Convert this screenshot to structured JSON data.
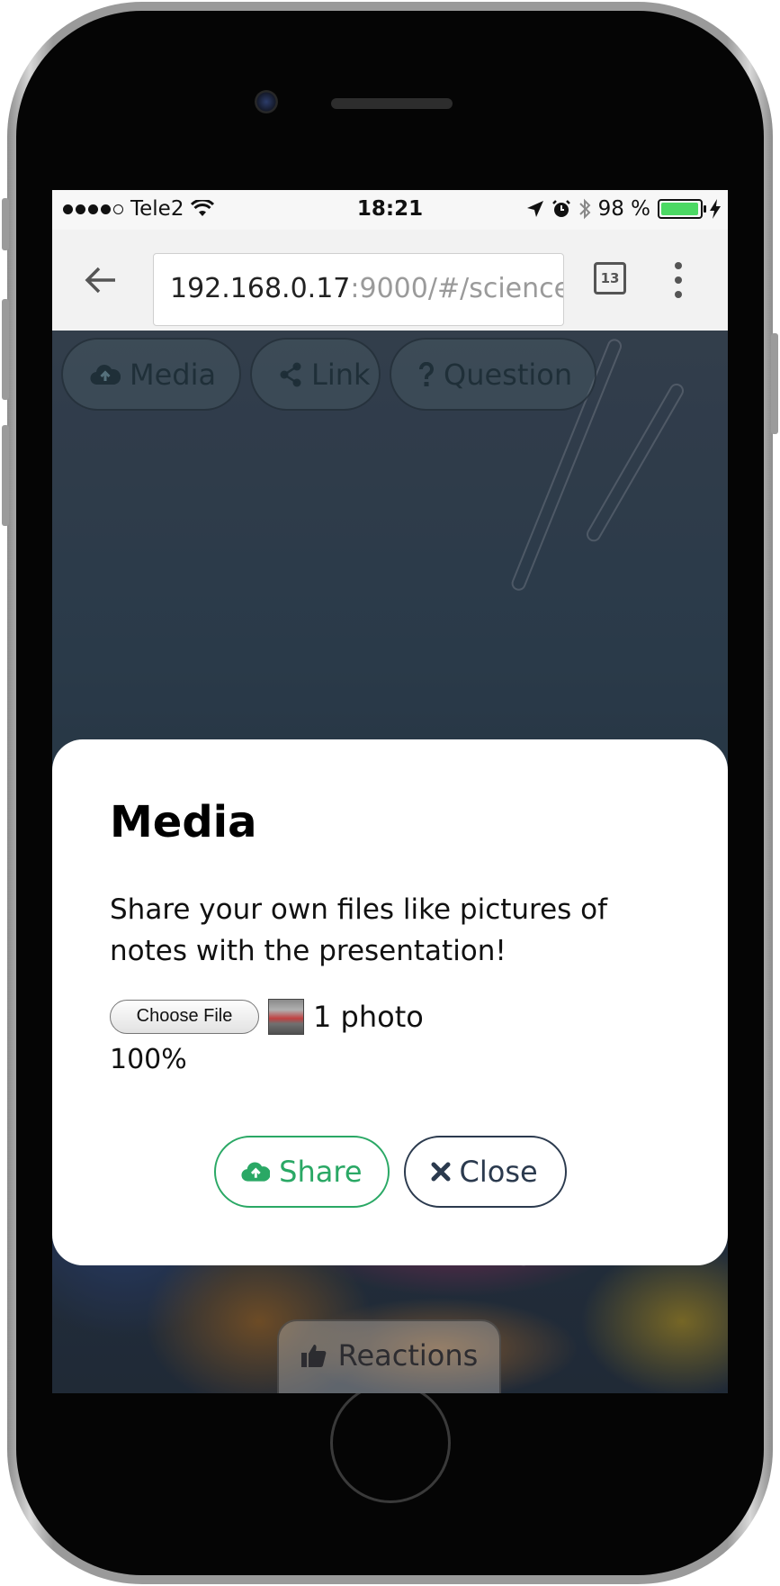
{
  "status_bar": {
    "carrier": "Tele2",
    "time": "18:21",
    "battery": "98 %",
    "battery_level": 0.98
  },
  "browser": {
    "url_host": "192.168.0.17",
    "url_path": ":9000/#/science",
    "tab_count": "13"
  },
  "toolbar": {
    "media_label": "Media",
    "link_label": "Link",
    "question_label": "Question"
  },
  "modal": {
    "title": "Media",
    "description": "Share your own files like pictures of notes with the presentation!",
    "choose_file_label": "Choose File",
    "file_count": "1 photo",
    "progress": "100%",
    "share_label": "Share",
    "close_label": "Close"
  },
  "footer": {
    "reactions_label": "Reactions"
  },
  "colors": {
    "share_green": "#2aa865",
    "close_navy": "#2b3a4e",
    "battery_green": "#4cd964"
  }
}
